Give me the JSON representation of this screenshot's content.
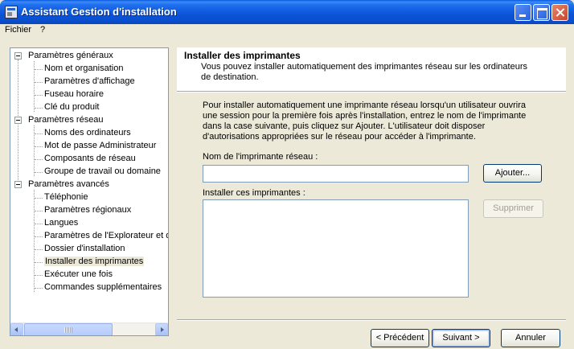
{
  "window": {
    "title": "Assistant Gestion d'installation"
  },
  "menu": [
    "Fichier",
    "?"
  ],
  "tree": {
    "groups": [
      {
        "label": "Paramètres généraux",
        "items": [
          "Nom et organisation",
          "Paramètres d'affichage",
          "Fuseau horaire",
          "Clé du produit"
        ]
      },
      {
        "label": "Paramètres réseau",
        "items": [
          "Noms des ordinateurs",
          "Mot de passe Administrateur",
          "Composants de réseau",
          "Groupe de travail ou domaine"
        ]
      },
      {
        "label": "Paramètres avancés",
        "items": [
          "Téléphonie",
          "Paramètres régionaux",
          "Langues",
          "Paramètres de l'Explorateur et de",
          "Dossier d'installation",
          "Installer des imprimantes",
          "Exécuter une fois",
          "Commandes supplémentaires"
        ]
      }
    ],
    "selected": "Installer des imprimantes"
  },
  "page": {
    "title": "Installer des imprimantes",
    "subtitle": "Vous pouvez installer automatiquement des imprimantes réseau sur les ordinateurs de destination.",
    "instructions": "Pour installer automatiquement une imprimante réseau lorsqu'un utilisateur ouvrira une session pour la première fois après l'installation, entrez le nom de l'imprimante dans la case suivante, puis cliquez sur Ajouter. L'utilisateur doit disposer d'autorisations appropriées sur le réseau pour accéder à l'imprimante.",
    "printer_name_label": "Nom de l'imprimante réseau :",
    "printer_name_value": "",
    "install_list_label": "Installer ces imprimantes :",
    "add_button": "Ajouter...",
    "remove_button": "Supprimer"
  },
  "nav": {
    "back": "< Précédent",
    "next": "Suivant >",
    "cancel": "Annuler"
  }
}
